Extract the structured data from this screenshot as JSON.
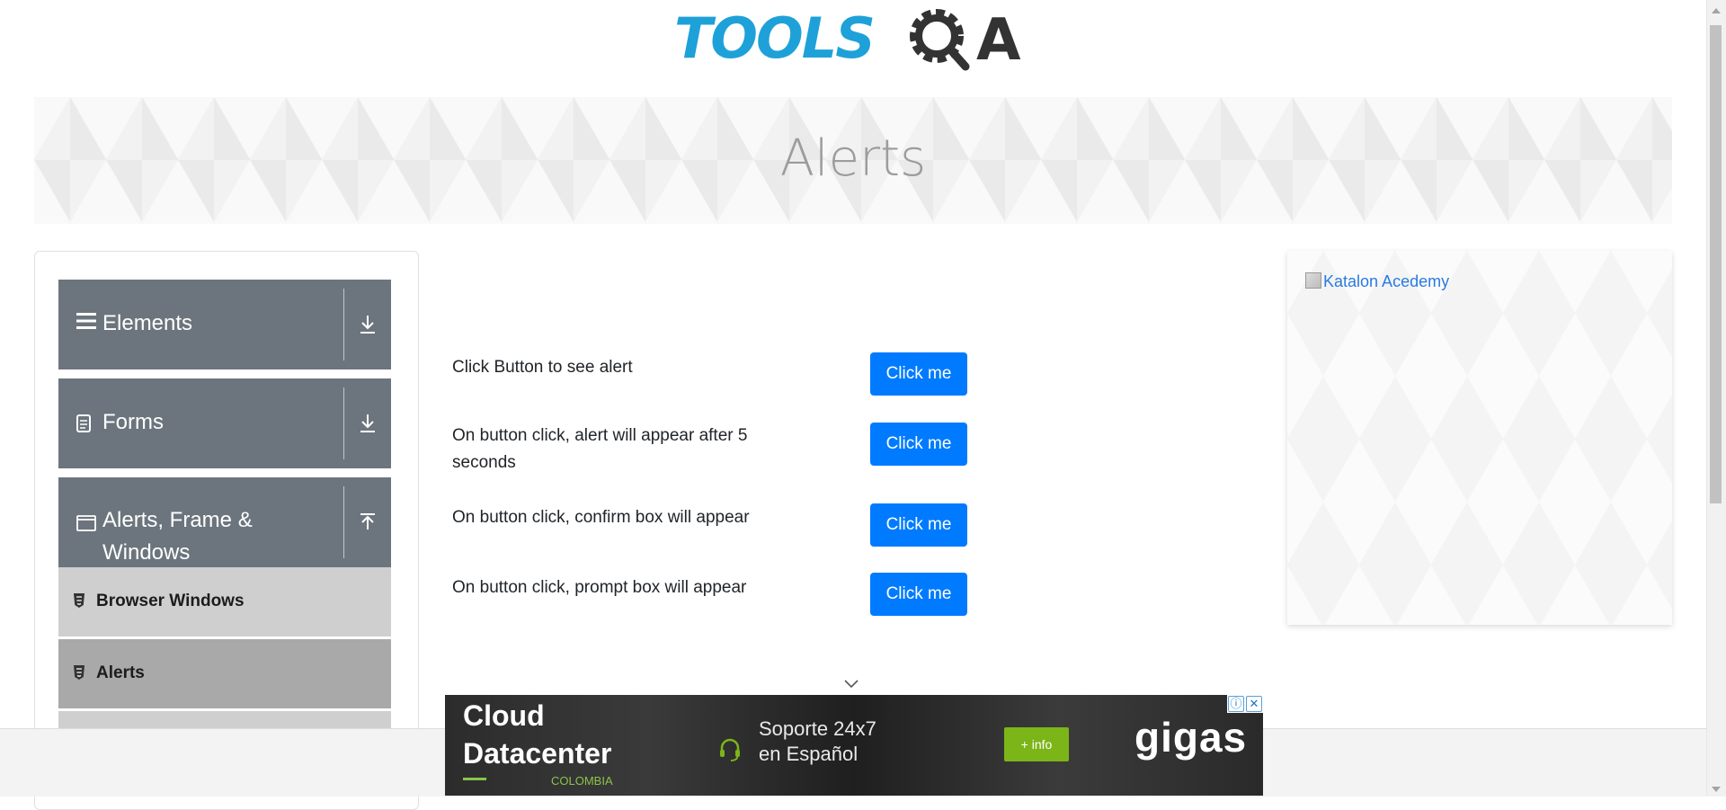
{
  "header": {
    "logo_text_left": "TOOLS",
    "logo_text_right": "A"
  },
  "banner": {
    "title": "Alerts"
  },
  "leftnav": {
    "groups": [
      {
        "label": "Elements",
        "icon": "hamburger-icon",
        "arrow": "download-arrow-icon"
      },
      {
        "label": "Forms",
        "icon": "document-icon",
        "arrow": "download-arrow-icon"
      },
      {
        "label": "Alerts, Frame &",
        "label_line2": "Windows",
        "icon": "window-icon",
        "arrow": "upload-arrow-icon"
      }
    ],
    "items": [
      {
        "label": "Browser Windows",
        "icon": "html5-icon",
        "active": false
      },
      {
        "label": "Alerts",
        "icon": "html5-icon",
        "active": true
      }
    ]
  },
  "main": {
    "rows": [
      {
        "text": "Click Button to see alert",
        "button": "Click me"
      },
      {
        "text": "On button click, alert will appear after 5",
        "text_line2": "seconds",
        "button": "Click me"
      },
      {
        "text": "On button click, confirm box will appear",
        "button": "Click me"
      },
      {
        "text": "On button click, prompt box will appear",
        "button": "Click me"
      }
    ]
  },
  "right_ad": {
    "alt_text": "Katalon Acedemy"
  },
  "bottom_ad": {
    "line1": "Cloud",
    "line2": "Datacenter",
    "country": "COLOMBIA",
    "support_line1": "Soporte 24x7",
    "support_line2": "en Español",
    "info_button": "+ info",
    "logo": "gigas",
    "info_icon": "ⓘ",
    "close_icon": "✕"
  },
  "colors": {
    "accent": "#007bff",
    "nav_header": "#6c757d",
    "logo_blue": "#1ea1d8",
    "logo_dark": "#333333",
    "ad_green": "#7cb518"
  }
}
